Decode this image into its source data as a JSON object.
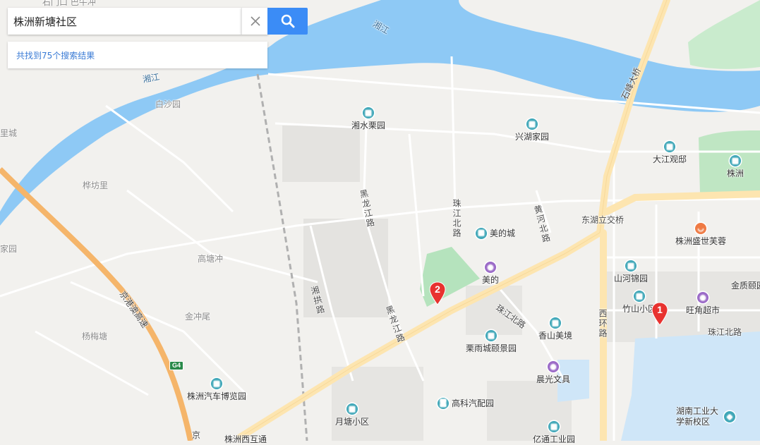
{
  "search": {
    "query": "株洲新塘社区",
    "result_summary": "共找到75个搜索结果"
  },
  "markers": [
    {
      "label": "1"
    },
    {
      "label": "2"
    }
  ],
  "labels": {
    "xiang_river": "湘江",
    "river_top": "湘江",
    "baishayuan": "白沙园",
    "lishucheng": "里城",
    "huafangli": "桦坊里",
    "jiayuan": "家园",
    "gaotangchong": "高塘冲",
    "jinchongwei": "金冲尾",
    "yangmeitang": "杨梅塘",
    "jinggangao": "京港澳高速",
    "g4": "G4",
    "shifeng_bridge": "石峰大桥",
    "heilongjiang_rd1": "黑龙江路",
    "heilongjiang_rd2": "黑龙江路",
    "zhujiang_north1": "珠江北路",
    "zhujiang_north2": "珠江北路",
    "zhujiang_north3": "珠江北路",
    "huanghe_north": "黄河北路",
    "donghu_interchange": "东湖立交桥",
    "xihuan_rd": "西环路",
    "xiangqian_rd": "湘拱路",
    "jing_bottom": "京",
    "top_partial": "石门口 巴牛冲"
  },
  "pois": [
    {
      "name": "湘水栗园",
      "icon": "building-icon"
    },
    {
      "name": "兴湖家园",
      "icon": "building-icon"
    },
    {
      "name": "大江观邸",
      "icon": "building-icon"
    },
    {
      "name": "株洲",
      "icon": "building-icon"
    },
    {
      "name": "美的城",
      "icon": "building-icon"
    },
    {
      "name": "美的",
      "icon": "shopping-icon"
    },
    {
      "name": "株洲盛世芙蓉",
      "icon": "food-icon"
    },
    {
      "name": "山河锦园",
      "icon": "building-icon"
    },
    {
      "name": "金质颐园",
      "icon": "building-icon"
    },
    {
      "name": "竹山小区",
      "icon": "building-icon"
    },
    {
      "name": "旺角超市",
      "icon": "shopping-icon"
    },
    {
      "name": "香山美境",
      "icon": "building-icon"
    },
    {
      "name": "栗雨城颐景园",
      "icon": "building-icon"
    },
    {
      "name": "晨光文具",
      "icon": "shopping-icon"
    },
    {
      "name": "高科汽配园",
      "icon": "car-icon"
    },
    {
      "name": "株洲汽车博览园",
      "icon": "building-icon"
    },
    {
      "name": "月塘小区",
      "icon": "building-icon"
    },
    {
      "name": "亿通工业园",
      "icon": "building-icon"
    },
    {
      "name": "湖南工业大学新校区",
      "icon": "school-icon"
    },
    {
      "name": "株洲西互通",
      "icon": "building-icon"
    }
  ],
  "colors": {
    "water": "#8ec9f5",
    "land": "#f2f1ee",
    "highway": "#f5b56a",
    "main_road": "#fde5b0",
    "green": "#bfe6c3",
    "search_button": "#3b8cf6",
    "marker": "#e8322f"
  }
}
